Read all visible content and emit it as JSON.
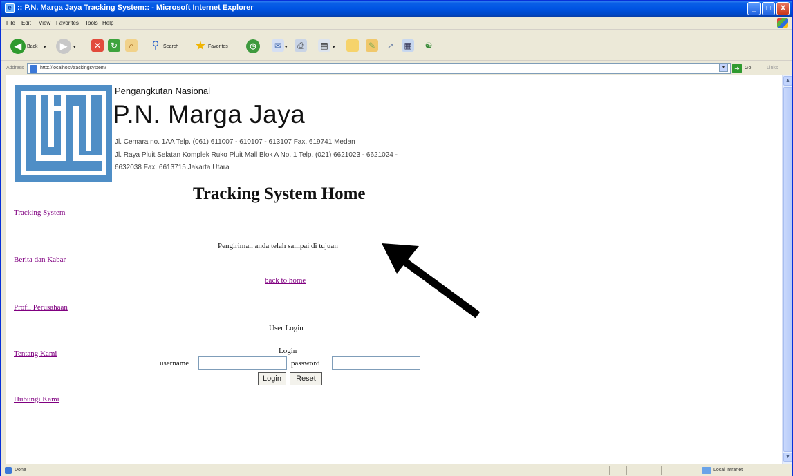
{
  "window": {
    "title": ":: P.N. Marga Jaya Tracking System:: - Microsoft Internet Explorer",
    "controls": [
      "_",
      "□",
      "X"
    ]
  },
  "menu": [
    "File",
    "Edit",
    "View",
    "Favorites",
    "Tools",
    "Help"
  ],
  "toolbar": {
    "back_label": "Back",
    "search_label": "Search",
    "favorites_label": "Favorites"
  },
  "address": {
    "label": "Address",
    "url": "http://localhost/trackingsystem/",
    "go_label": "Go",
    "links_label": "Links"
  },
  "header": {
    "tagline": "Pengangkutan Nasional",
    "company_name": "P.N. Marga Jaya",
    "address_lines": [
      "Jl. Cemara no. 1AA Telp. (061) 611007 - 610107 - 613107 Fax. 619741 Medan",
      "Jl. Raya Pluit Selatan Komplek Ruko Pluit Mall Blok A No. 1 Telp. (021) 6621023 - 6621024 -",
      "6632038 Fax. 6613715 Jakarta Utara"
    ]
  },
  "page": {
    "heading": "Tracking System Home",
    "message": "Pengiriman anda telah sampai di tujuan",
    "back_link": "back to home"
  },
  "nav": [
    "Tracking System",
    "Berita dan Kabar",
    "Profil Perusahaan",
    "Tentang Kami",
    "Hubungi Kami"
  ],
  "login": {
    "title": "User Login",
    "subtitle": "Login",
    "username_label": "username",
    "password_label": "password",
    "username_value": "",
    "password_value": "",
    "login_button": "Login",
    "reset_button": "Reset"
  },
  "status": {
    "text": "Done",
    "zone": "Local intranet"
  },
  "colors": {
    "logo_blue": "#4f8ec6",
    "visited_link": "#800080",
    "title_bar": "#0054e3"
  }
}
